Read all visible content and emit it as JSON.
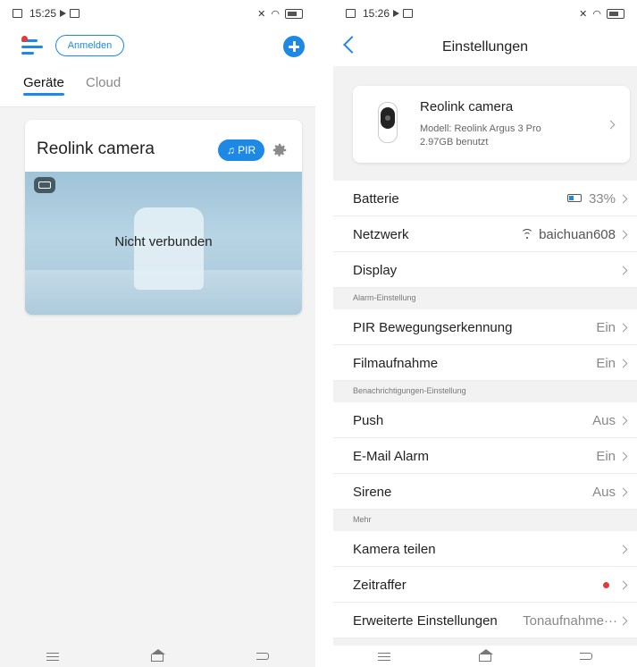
{
  "left": {
    "status_time": "15:25",
    "login_label": "Anmelden",
    "tabs": [
      {
        "label": "Geräte"
      },
      {
        "label": "Cloud"
      }
    ],
    "device": {
      "name": "Reolink camera",
      "pir_label": "PIR",
      "status": "Nicht verbunden"
    }
  },
  "right": {
    "status_time": "15:26",
    "title": "Einstellungen",
    "camera": {
      "name": "Reolink camera",
      "model": "Modell:  Reolink Argus 3 Pro",
      "storage": "2.97GB benutzt"
    },
    "rows": {
      "battery": {
        "label": "Batterie",
        "value": "33%"
      },
      "network": {
        "label": "Netzwerk",
        "value": "baichuan608"
      },
      "display": {
        "label": "Display"
      },
      "alarm_section": "Alarm-Einstellung",
      "pir": {
        "label": "PIR Bewegungserkennung",
        "value": "Ein"
      },
      "recording": {
        "label": "Filmaufnahme",
        "value": "Ein"
      },
      "notify_section": "Benachrichtigungen-Einstellung",
      "push": {
        "label": "Push",
        "value": "Aus"
      },
      "email": {
        "label": "E-Mail Alarm",
        "value": "Ein"
      },
      "siren": {
        "label": "Sirene",
        "value": "Aus"
      },
      "more_section": "Mehr",
      "share": {
        "label": "Kamera teilen"
      },
      "timelapse": {
        "label": "Zeitraffer"
      },
      "advanced": {
        "label": "Erweiterte Einstellungen",
        "value": "Tonaufnahme···"
      }
    }
  },
  "colors": {
    "accent": "#1e88e5",
    "alert": "#e53935"
  },
  "icons": [
    "hamburger-icon",
    "plus-icon",
    "bell-icon",
    "gear-icon",
    "battery-icon",
    "wifi-icon",
    "back-arrow-icon",
    "chevron-right-icon"
  ]
}
